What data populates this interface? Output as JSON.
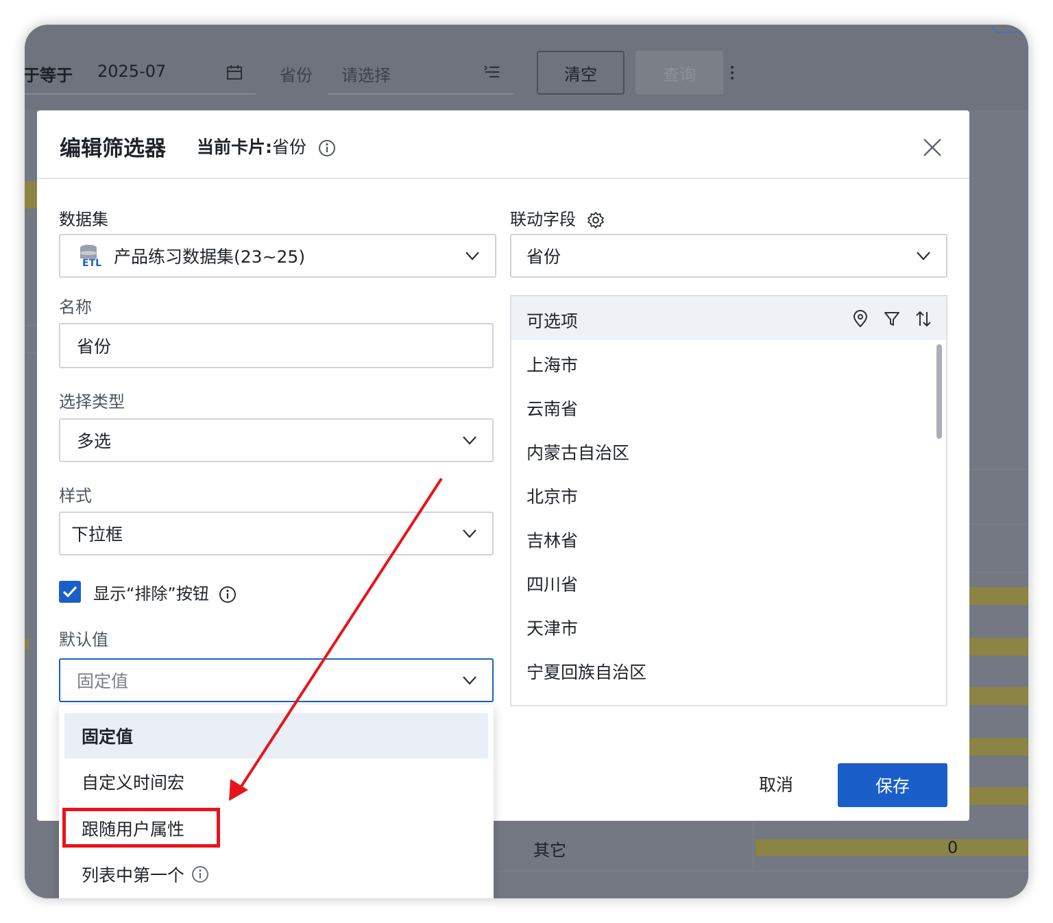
{
  "background": {
    "filter_label": "于等于",
    "date_value": "2025-07",
    "province_label": "省份",
    "province_placeholder": "请选择",
    "clear_label": "清空",
    "query_label": "查询",
    "other_label": "其它",
    "other_value": "0"
  },
  "modal": {
    "title": "编辑筛选器",
    "card_prefix": "当前卡片:",
    "card_value": "省份",
    "dataset": {
      "label": "数据集",
      "value": "产品练习数据集(23~25)",
      "icon": "etl-icon"
    },
    "name": {
      "label": "名称",
      "value": "省份"
    },
    "select_type": {
      "label": "选择类型",
      "value": "多选"
    },
    "style": {
      "label": "样式",
      "value": "下拉框"
    },
    "show_exclude": {
      "label": "显示“排除”按钮",
      "checked": true
    },
    "default_value": {
      "label": "默认值",
      "value": "固定值"
    },
    "linked_field": {
      "label": "联动字段",
      "value": "省份"
    },
    "options": {
      "title": "可选项",
      "items": [
        "上海市",
        "云南省",
        "内蒙古自治区",
        "北京市",
        "吉林省",
        "四川省",
        "天津市",
        "宁夏回族自治区"
      ]
    },
    "cancel_label": "取消",
    "save_label": "保存"
  },
  "default_menu": {
    "items": [
      "固定值",
      "自定义时间宏",
      "跟随用户属性",
      "列表中第一个"
    ],
    "selected": "固定值",
    "highlighted": "跟随用户属性"
  },
  "colors": {
    "primary": "#1a5fc9",
    "annotation": "#e8141b",
    "selected_bg": "#e9eef7"
  }
}
